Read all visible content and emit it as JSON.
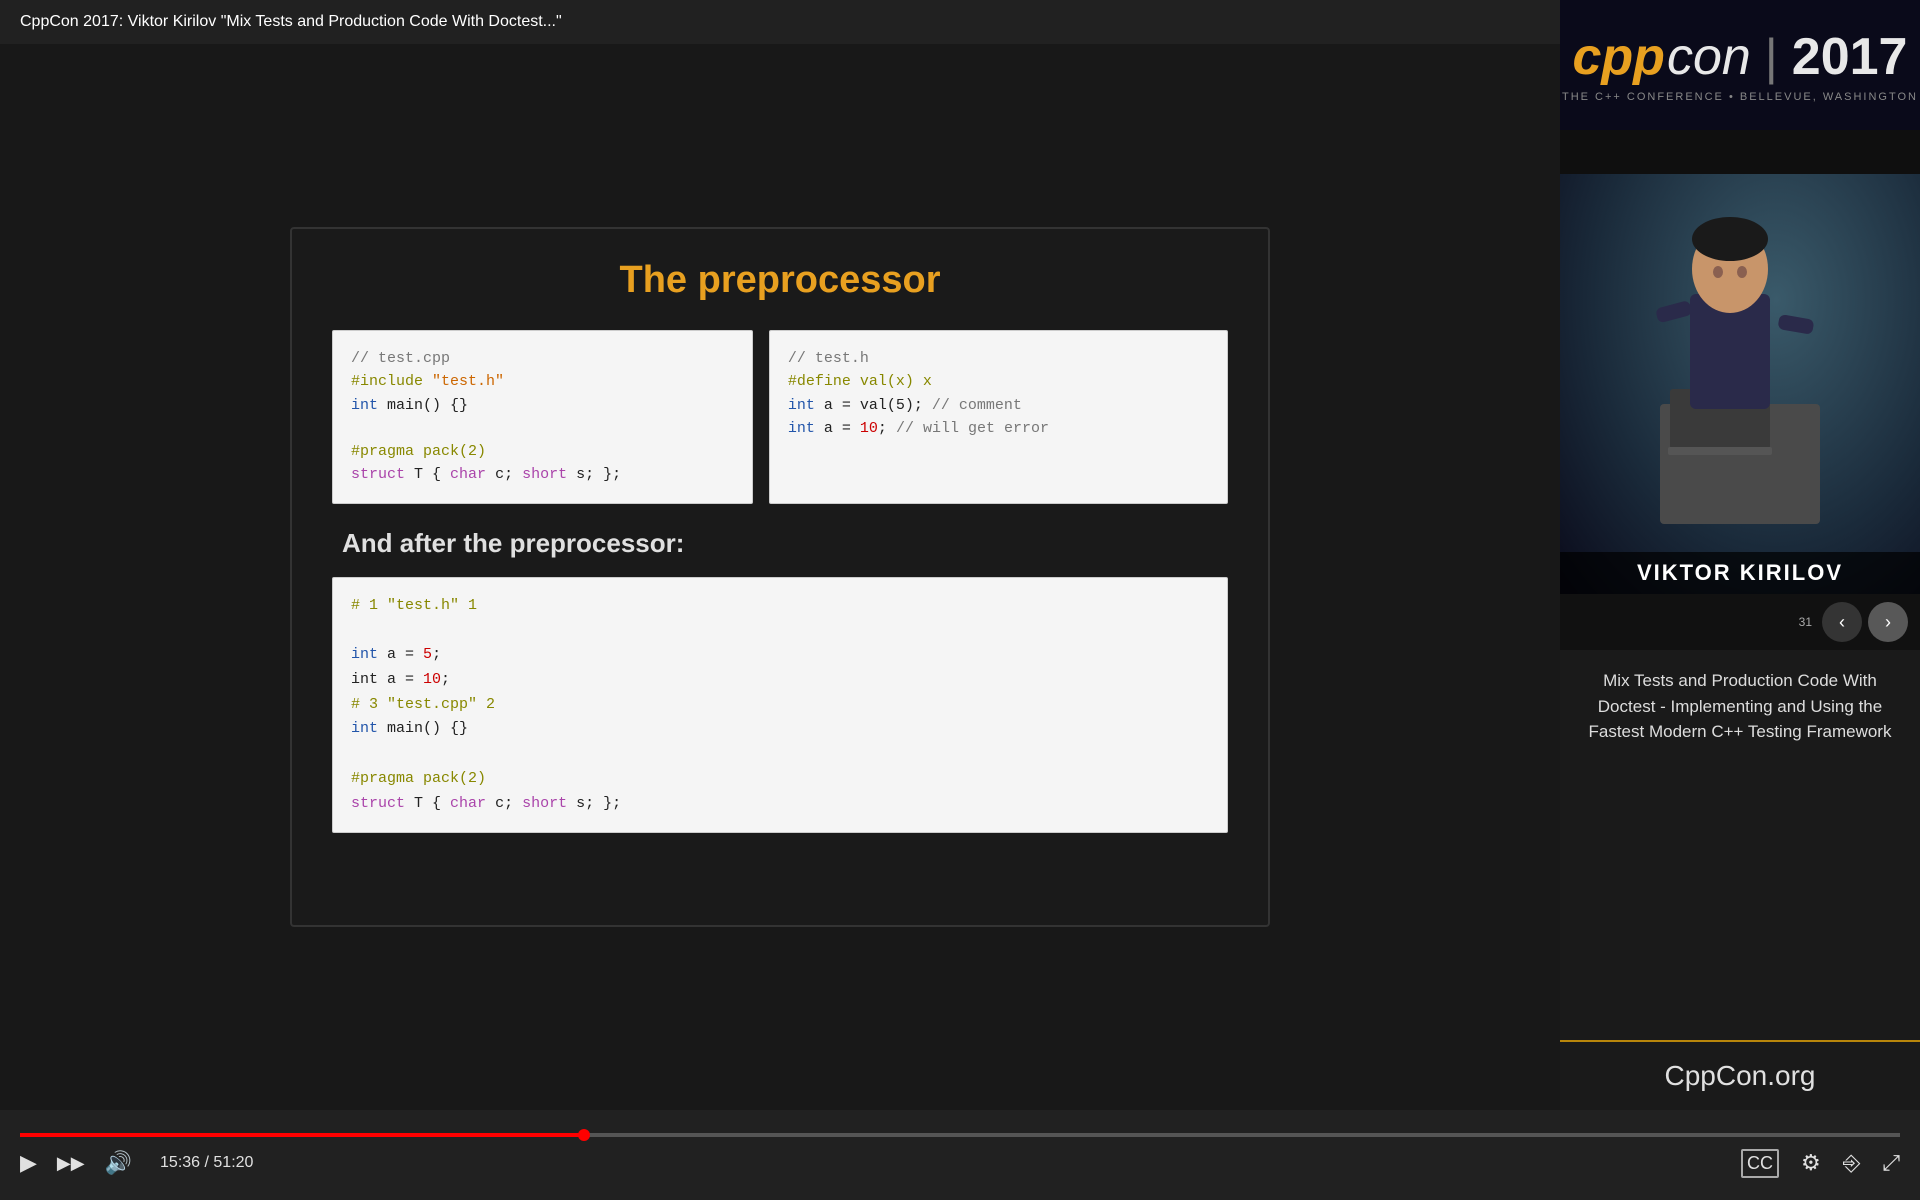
{
  "topbar": {
    "title": "CppCon 2017: Viktor Kirilov \"Mix Tests and Production Code With Doctest...\"",
    "icon_history": "🕐",
    "icon_share": "➤"
  },
  "slide": {
    "title": "The preprocessor",
    "after_label": "And after the preprocessor:",
    "code_left": {
      "line1_comment": "// test.cpp",
      "line2": "#include \"test.h\"",
      "line3": "int main() {}",
      "line4": "",
      "line5": "#pragma pack(2)",
      "line6": "struct T { char c; short s; };"
    },
    "code_right": {
      "line1_comment": "// test.h",
      "line2": "#define val(x) x",
      "line3": "int a = val(5); // comment",
      "line4": "int a = 10; // will get error"
    },
    "code_bottom": {
      "line1": "# 1 \"test.h\" 1",
      "line2": "",
      "line3": "int a = 5;",
      "line4": "int a = 10;",
      "line5": "# 3 \"test.cpp\" 2",
      "line6": "int main() {}",
      "line7": "",
      "line8": "#pragma pack(2)",
      "line9": "struct T { char c; short s; };"
    }
  },
  "sidebar": {
    "speaker_name": "VIKTOR KIRILOV",
    "description": "Mix Tests and Production Code With Doctest - Implementing and Using the Fastest Modern C++ Testing Framework",
    "website": "CppCon.org",
    "slide_number": "31"
  },
  "logo": {
    "cpp": "cpp",
    "con": "con",
    "divider": "|",
    "year": "2017",
    "subtitle": "THE C++ CONFERENCE • BELLEVUE, WASHINGTON"
  },
  "controls": {
    "time_current": "15:36",
    "time_total": "51:20"
  }
}
